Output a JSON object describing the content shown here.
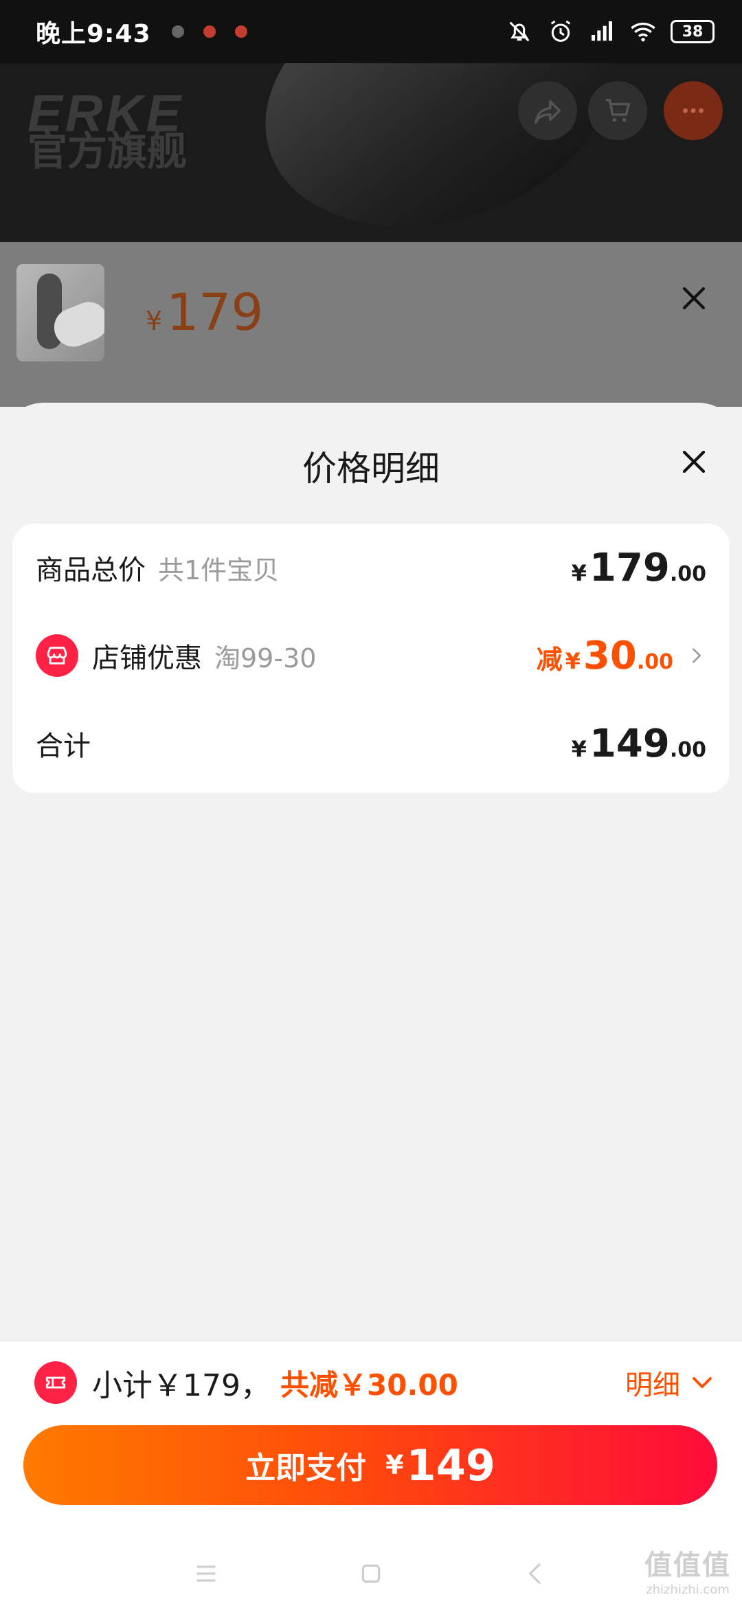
{
  "status_bar": {
    "time": "晚上9:43",
    "battery": "38"
  },
  "header": {
    "brand": "ERKE",
    "brand_sub": "官方旗舰",
    "icons": [
      "back-icon",
      "share-icon",
      "cart-icon",
      "more-icon"
    ]
  },
  "product": {
    "currency": "¥",
    "price": "179"
  },
  "sheet": {
    "title": "价格明细",
    "rows": [
      {
        "label": "商品总价",
        "sub": "共1件宝贝",
        "prefix": "",
        "yen": "¥",
        "int": "179",
        "dec": ".00"
      },
      {
        "label": "店铺优惠",
        "sub": "淘99-30",
        "prefix": "减",
        "yen": "¥",
        "int": "30",
        "dec": ".00"
      },
      {
        "label": "合计",
        "sub": "",
        "prefix": "",
        "yen": "¥",
        "int": "149",
        "dec": ".00"
      }
    ]
  },
  "footer": {
    "subtotal": "小计￥179，",
    "discount": "共减￥30.00",
    "detail_label": "明细",
    "pay_label": "立即支付",
    "pay_yen": "¥",
    "pay_amount": "149"
  },
  "watermark": {
    "big": "值值值",
    "small": "zhizhizhi.com"
  },
  "colors": {
    "accent": "#ff5000",
    "badge": "#ff2244",
    "pay_start": "#ff7a00",
    "pay_end": "#ff0b3a"
  }
}
